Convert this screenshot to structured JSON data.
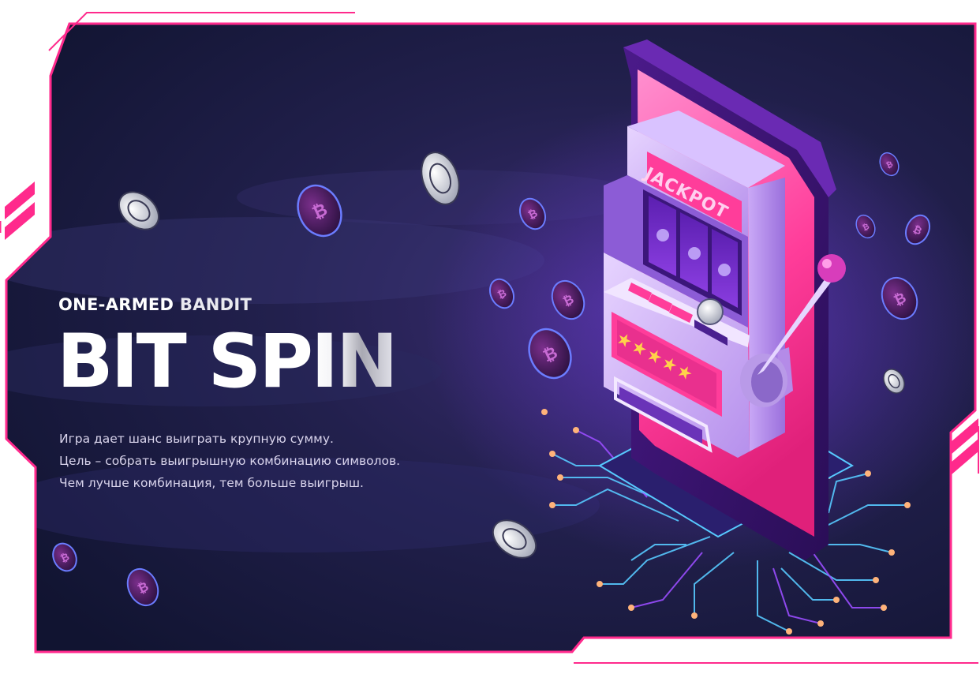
{
  "banner": {
    "eyebrow_part1": "ONE-ARMED",
    "eyebrow_part2": "BANDIT",
    "title_part1": "BIT SP",
    "title_part2": "IN",
    "description": [
      "Игра дает шанс выиграть крупную сумму.",
      "Цель – собрать выигрышную комбинацию символов.",
      "Чем лучше комбинация, тем больше выигрыш."
    ]
  },
  "slot_machine": {
    "sign": "JACKPOT",
    "stars": "★★★★★"
  },
  "icons": {
    "coin_bitcoin": "bitcoin-coin-icon",
    "coin_silver": "crypto-coin-icon",
    "lever": "lever-icon"
  },
  "colors": {
    "frame": "#ff2a8c",
    "background": "#17163a",
    "accent_pink": "#ff3d9a",
    "accent_purple": "#8a3cd8",
    "circuit": "#57c9ff"
  }
}
